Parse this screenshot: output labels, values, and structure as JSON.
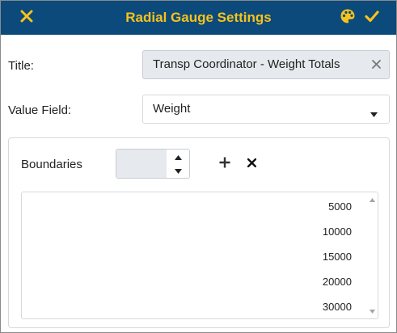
{
  "dialog": {
    "title": "Radial Gauge Settings",
    "colors": {
      "header_bg": "#0b4a7a",
      "header_fg": "#f7c21b"
    },
    "icons": {
      "close": "close-icon",
      "palette": "palette-icon",
      "confirm": "check-icon"
    }
  },
  "form": {
    "title_label": "Title:",
    "title_value": "Transp Coordinator - Weight Totals",
    "value_field_label": "Value Field:",
    "value_field_selected": "Weight"
  },
  "boundaries": {
    "label": "Boundaries",
    "input_value": "",
    "items": [
      "5000",
      "10000",
      "15000",
      "20000",
      "30000"
    ]
  }
}
